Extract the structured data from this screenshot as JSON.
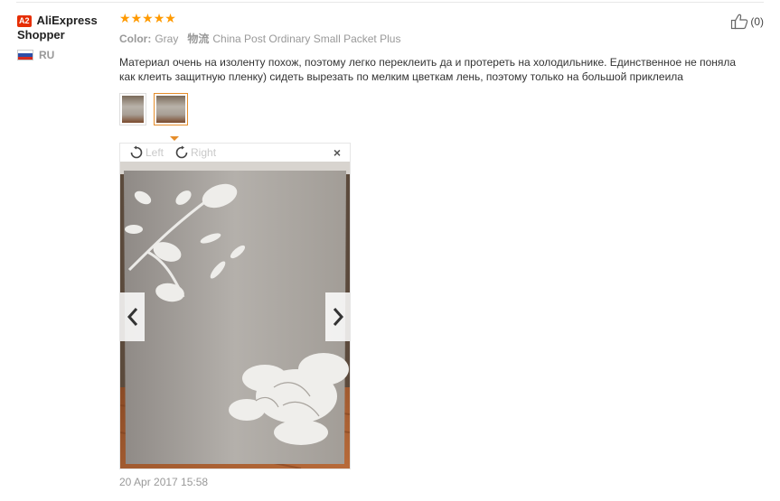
{
  "user": {
    "badge": "A2",
    "name_line1": "AliExpress",
    "name_line2": "Shopper",
    "country": "RU"
  },
  "review": {
    "rating": 5,
    "color_label": "Color:",
    "color_value": "Gray",
    "shipping_label": "物流",
    "shipping_value": "China Post Ordinary Small Packet Plus",
    "text": "Материал очень на изоленту похож, поэтому легко переклеить да и протереть на холодильнике. Единственное не поняла как клеить защитную пленку) сидеть вырезать по мелким цветкам лень, поэтому только на большой приклеила",
    "date": "20 Apr 2017 15:58"
  },
  "helpful": {
    "count": "(0)",
    "icon": "thumbs-up-icon"
  },
  "viewer": {
    "rotate_left_label": "Left",
    "rotate_right_label": "Right",
    "close_label": "×",
    "thumbnail_count": 2,
    "active_thumbnail": 2
  },
  "colors": {
    "star": "#ff9a00",
    "badge": "#e62e04",
    "active_thumb_border": "#e58d2b"
  }
}
